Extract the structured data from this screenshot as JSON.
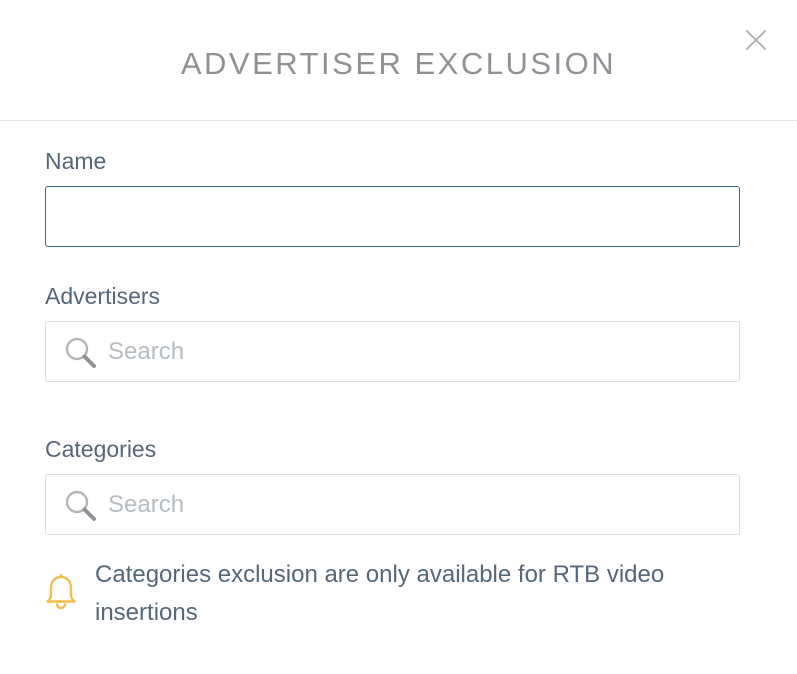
{
  "modal": {
    "title": "ADVERTISER EXCLUSION",
    "close_icon": "close-icon"
  },
  "form": {
    "name": {
      "label": "Name",
      "value": "",
      "placeholder": ""
    },
    "advertisers": {
      "label": "Advertisers",
      "placeholder": "Search",
      "icon": "search-icon"
    },
    "categories": {
      "label": "Categories",
      "placeholder": "Search",
      "icon": "search-icon"
    }
  },
  "notice": {
    "icon": "bell-icon",
    "text": "Categories exclusion are only available for RTB video insertions"
  },
  "colors": {
    "title": "#8e9296",
    "label": "#55677b",
    "input_border": "#d9dde1",
    "focus_border": "#3f6a90",
    "placeholder": "#b7bcc1",
    "bell": "#f3be4f"
  }
}
